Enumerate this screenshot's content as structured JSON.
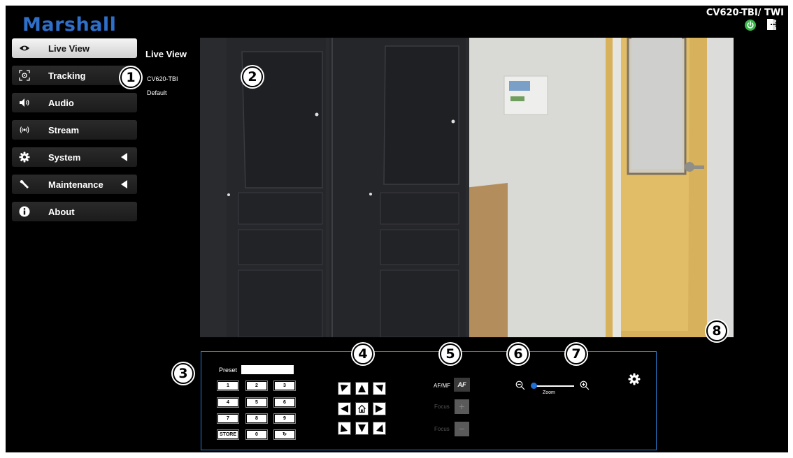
{
  "brand": "Marshall",
  "model": "CV620-TBI/ TWI",
  "sidebar": {
    "items": [
      {
        "label": "Live View",
        "icon": "eye-icon",
        "active": true
      },
      {
        "label": "Tracking",
        "icon": "tracking-icon"
      },
      {
        "label": "Audio",
        "icon": "speaker-icon"
      },
      {
        "label": "Stream",
        "icon": "stream-icon"
      },
      {
        "label": "System",
        "icon": "gear-icon",
        "expandable": true
      },
      {
        "label": "Maintenance",
        "icon": "wrench-icon",
        "expandable": true
      },
      {
        "label": "About",
        "icon": "info-icon"
      }
    ]
  },
  "main": {
    "title": "Live View",
    "camera_name": "CV620-TBI",
    "profile": "Default"
  },
  "controls": {
    "preset_label": "Preset",
    "preset_value": "",
    "preset_buttons": [
      "1",
      "2",
      "3",
      "4",
      "5",
      "6",
      "7",
      "8",
      "9",
      "STORE",
      "0",
      "↻"
    ],
    "af_mf_label": "AF/MF",
    "af_button": "AF",
    "focus_near_label": "Focus",
    "focus_far_label": "Focus",
    "focus_plus": "+",
    "focus_minus": "−",
    "zoom_label": "Zoom",
    "zoom_level": 0
  },
  "callouts": [
    "1",
    "2",
    "3",
    "4",
    "5",
    "6",
    "7",
    "8"
  ],
  "colors": {
    "brand": "#2e6fc9",
    "power": "#3bb54a",
    "panel_border": "#2a7fd0",
    "zoom_knob": "#1f6fd8"
  }
}
